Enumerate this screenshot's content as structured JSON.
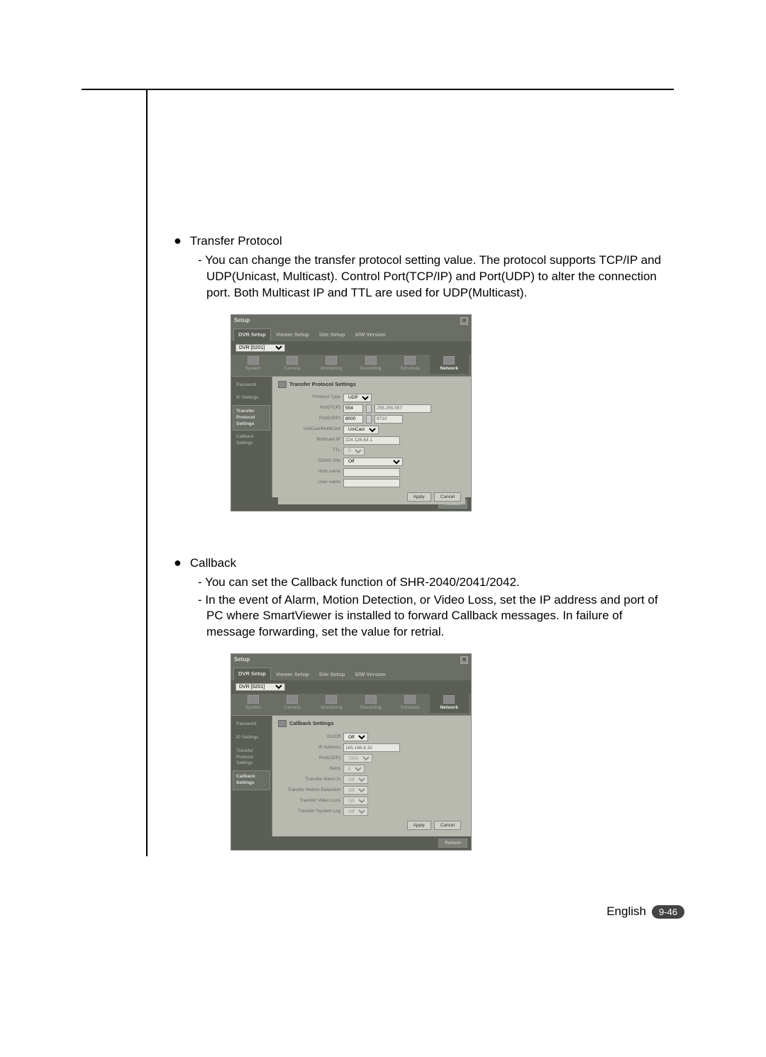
{
  "sections": {
    "transfer": {
      "title": "Transfer Protocol",
      "desc1": "- You can change the transfer protocol setting value. The protocol supports TCP/IP and UDP(Unicast, Multicast). Control Port(TCP/IP) and Port(UDP) to alter the connection port. Both Multicast IP and TTL are used for UDP(Multicast)."
    },
    "callback": {
      "title": "Callback",
      "desc1": "- You can set the Callback function of SHR-2040/2041/2042.",
      "desc2": "- In the event of Alarm, Motion Detection, or Video Loss, set the IP address and port of PC where SmartViewer is installed to forward Callback messages. In failure of message forwarding, set the value for retrial."
    }
  },
  "dialog": {
    "title": "Setup",
    "close": "✕",
    "tabs": [
      "DVR Setup",
      "Viewer Setup",
      "Site Setup",
      "S/W Version"
    ],
    "dropdown": "DVR [0201]",
    "icons": [
      "System",
      "Camera",
      "Monitoring",
      "Recording",
      "Schedule",
      "Network"
    ],
    "side": [
      "Password",
      "IP Settings",
      "Transfer Protocol Settings",
      "Callback Settings"
    ],
    "apply": "Apply",
    "cancel": "Cancel",
    "refresh": "Refresh"
  },
  "transfer_form": {
    "panel_title": "Transfer Protocol Settings",
    "rows": {
      "protocol_type": {
        "label": "Protocol Type",
        "value": "UDP"
      },
      "port_tcp": {
        "label": "Port(TCP)",
        "value": "554",
        "extra": "255.255.557"
      },
      "port_udp": {
        "label": "Port(UDP)",
        "value": "8000",
        "extra": "9710"
      },
      "unicast": {
        "label": "UniCast/MultiCast",
        "value": "UniCast"
      },
      "multicast_ip": {
        "label": "Multicast IP",
        "value": "224.126.63.1"
      },
      "ttl": {
        "label": "TTL",
        "value": "5"
      },
      "ddns_site": {
        "label": "DDNS Site",
        "value": "Off"
      },
      "hostname": {
        "label": "Host name",
        "value": ""
      },
      "username": {
        "label": "User name",
        "value": ""
      }
    }
  },
  "callback_form": {
    "panel_title": "Callback Settings",
    "rows": {
      "onoff": {
        "label": "On/Off",
        "value": "Off"
      },
      "ip": {
        "label": "IP Address",
        "value": "165.186.8.32"
      },
      "port": {
        "label": "Port(UDP)",
        "value": "7900"
      },
      "retry": {
        "label": "Retry",
        "value": "5"
      },
      "alarm": {
        "label": "Transfer Alarm In",
        "value": "Off"
      },
      "motion": {
        "label": "Transfer Motion Detection",
        "value": "Off"
      },
      "vloss": {
        "label": "Transfer Video Loss",
        "value": "Off"
      },
      "syslog": {
        "label": "Transfer System Log",
        "value": "Off"
      }
    }
  },
  "footer": {
    "lang": "English",
    "page": "9-46"
  }
}
